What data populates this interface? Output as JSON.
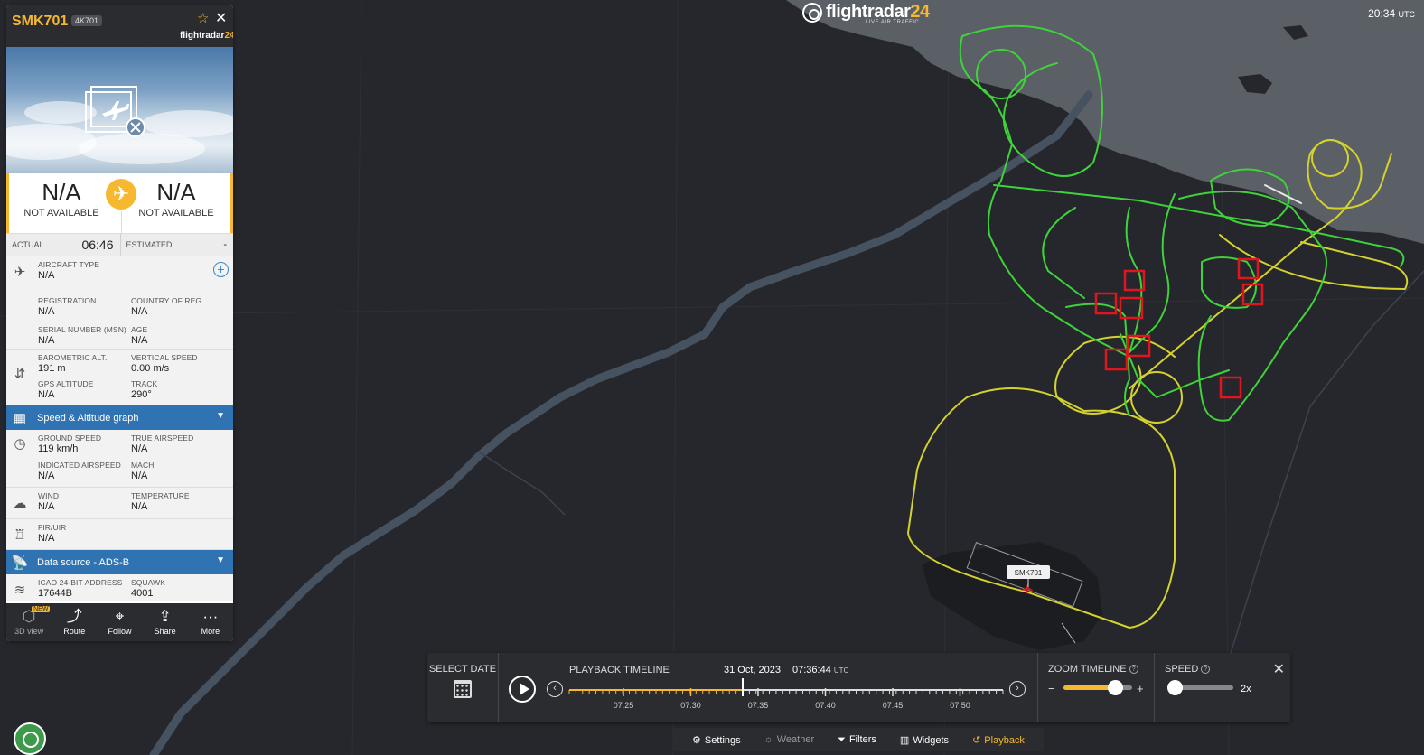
{
  "brand": {
    "name_main": "flightradar",
    "name_num": "24",
    "tagline": "LIVE AIR TRAFFIC"
  },
  "clock": {
    "time": "20:34",
    "zone": "UTC"
  },
  "flight": {
    "callsign": "SMK701",
    "reg_badge": "4K701",
    "logo_main": "flightradar",
    "logo_num": "24",
    "origin": {
      "code": "N/A",
      "name": "NOT AVAILABLE"
    },
    "destination": {
      "code": "N/A",
      "name": "NOT AVAILABLE"
    },
    "actual_label": "ACTUAL",
    "actual_time": "06:46",
    "estimated_label": "ESTIMATED",
    "estimated_time": "-",
    "aircraft_type_label": "AIRCRAFT TYPE",
    "aircraft_type": "N/A",
    "registration_label": "REGISTRATION",
    "registration": "N/A",
    "country_label": "COUNTRY OF REG.",
    "country": "N/A",
    "serial_label": "SERIAL NUMBER (MSN)",
    "serial": "N/A",
    "age_label": "AGE",
    "age": "N/A",
    "baro_label": "BAROMETRIC ALT.",
    "baro": "191 m",
    "vspeed_label": "VERTICAL SPEED",
    "vspeed": "0.00 m/s",
    "gps_label": "GPS ALTITUDE",
    "gps": "N/A",
    "track_label": "TRACK",
    "track": "290°",
    "speed_graph_label": "Speed & Altitude graph",
    "ground_speed_label": "GROUND SPEED",
    "ground_speed": "119 km/h",
    "tas_label": "TRUE AIRSPEED",
    "tas": "N/A",
    "ias_label": "INDICATED AIRSPEED",
    "ias": "N/A",
    "mach_label": "MACH",
    "mach": "N/A",
    "wind_label": "WIND",
    "wind": "N/A",
    "temp_label": "TEMPERATURE",
    "temp": "N/A",
    "fir_label": "FIR/UIR",
    "fir": "N/A",
    "datasource_label": "Data source - ADS-B",
    "icao_label": "ICAO 24-BIT ADDRESS",
    "icao": "17644B",
    "squawk_label": "SQUAWK",
    "squawk": "4001"
  },
  "toolbar": {
    "view3d": "3D view",
    "new_badge": "NEW",
    "route": "Route",
    "follow": "Follow",
    "share": "Share",
    "more": "More"
  },
  "map": {
    "aircraft_label": "SMK701",
    "track_green": "#3fd23a",
    "track_yellow": "#d4d22c",
    "marker_red": "#e0161e"
  },
  "playback": {
    "select_date": "SELECT DATE",
    "timeline_label": "PLAYBACK TIMELINE",
    "date": "31 Oct, 2023",
    "time": "07:36:44",
    "time_zone": "UTC",
    "ticks": [
      "07:25",
      "07:30",
      "07:35",
      "07:40",
      "07:45",
      "07:50"
    ],
    "progress": 0.4,
    "zoom_label": "ZOOM TIMELINE",
    "zoom_minus": "−",
    "zoom_plus": "+",
    "zoom_level": 0.75,
    "speed_label": "SPEED",
    "speed_value": "2x",
    "speed_level": 0.1,
    "help_glyph": "?"
  },
  "menu": {
    "settings": "Settings",
    "weather": "Weather",
    "filters": "Filters",
    "widgets": "Widgets",
    "playback": "Playback"
  }
}
